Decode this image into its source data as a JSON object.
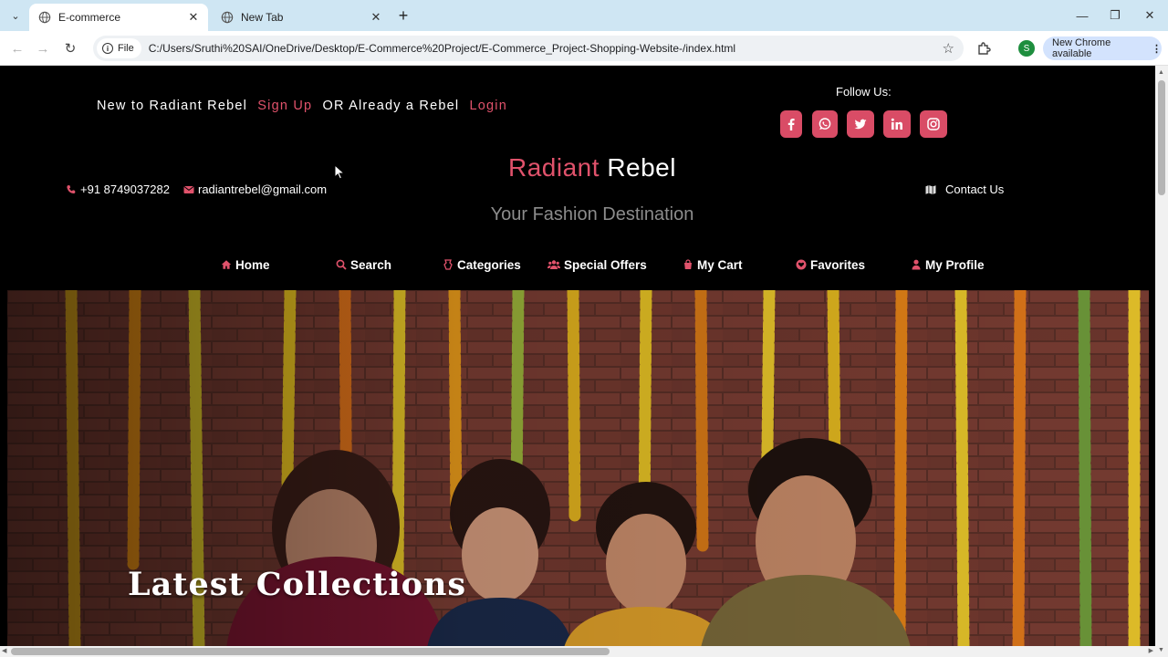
{
  "browser": {
    "tabs": [
      {
        "title": "E-commerce",
        "active": true
      },
      {
        "title": "New Tab",
        "active": false
      }
    ],
    "file_chip": "File",
    "url": "C:/Users/Sruthi%20SAI/OneDrive/Desktop/E-Commerce%20Project/E-Commerce_Project-Shopping-Website-/index.html",
    "profile_initial": "S",
    "update_label": "New Chrome available"
  },
  "header": {
    "auth": {
      "new_prefix": "New to Radiant Rebel",
      "signup": "Sign Up",
      "or_text": "OR Already a Rebel",
      "login": "Login"
    },
    "follow_label": "Follow Us:",
    "social_icons": [
      "facebook-icon",
      "whatsapp-icon",
      "twitter-icon",
      "linkedin-icon",
      "instagram-icon"
    ],
    "brand_part1": "Radiant",
    "brand_part2": "Rebel",
    "tagline": "Your Fashion Destination",
    "phone": "+91 8749037282",
    "email": "radiantrebel@gmail.com",
    "contact_link": "Contact Us"
  },
  "nav": {
    "items": [
      {
        "label": "Home",
        "icon": "home-icon"
      },
      {
        "label": "Search",
        "icon": "search-icon"
      },
      {
        "label": "Categories",
        "icon": "categories-icon"
      },
      {
        "label": "Special Offers",
        "icon": "users-icon"
      },
      {
        "label": "My Cart",
        "icon": "cart-icon"
      },
      {
        "label": "Favorites",
        "icon": "heart-icon"
      },
      {
        "label": "My Profile",
        "icon": "user-icon"
      }
    ]
  },
  "hero": {
    "title": "Latest Collections"
  },
  "colors": {
    "accent": "#e0526b",
    "page_bg": "#000000",
    "tagline": "#8c8c8c"
  }
}
